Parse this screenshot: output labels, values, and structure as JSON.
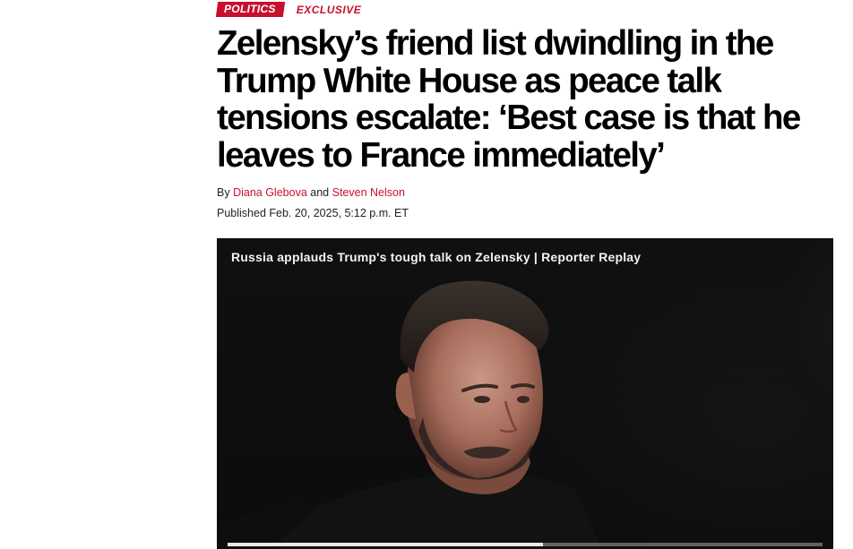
{
  "article": {
    "section_tag": "POLITICS",
    "exclusive_tag": "EXCLUSIVE",
    "headline_lines": [
      "Zelensky’s friend list dwindling in the",
      "Trump White House as peace talk",
      "tensions escalate: ‘Best case is that he",
      "leaves to France immediately’"
    ],
    "byline": {
      "prefix": "By",
      "author1": "Diana Glebova",
      "conjunction": "and",
      "author2": "Steven Nelson"
    },
    "published": "Published Feb. 20, 2025, 5:12 p.m. ET"
  },
  "video": {
    "title": "Russia applauds Trump's tough talk on Zelensky | Reporter Replay",
    "progress_fraction": 0.53
  },
  "colors": {
    "accent": "#c8102e",
    "headline": "#000000",
    "video_bg": "#0b0b0b"
  }
}
